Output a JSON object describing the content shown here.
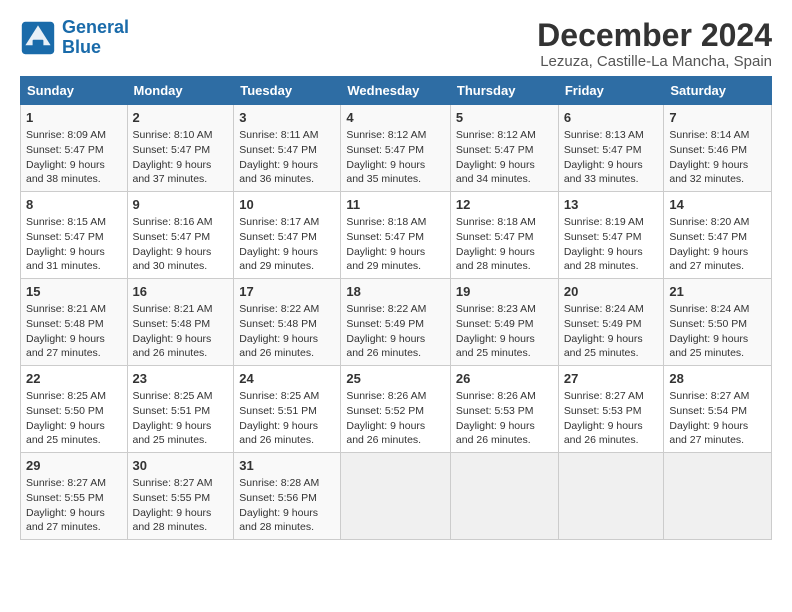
{
  "header": {
    "logo_line1": "General",
    "logo_line2": "Blue",
    "title": "December 2024",
    "subtitle": "Lezuza, Castille-La Mancha, Spain"
  },
  "columns": [
    "Sunday",
    "Monday",
    "Tuesday",
    "Wednesday",
    "Thursday",
    "Friday",
    "Saturday"
  ],
  "weeks": [
    [
      {
        "day": "1",
        "text": "Sunrise: 8:09 AM\nSunset: 5:47 PM\nDaylight: 9 hours\nand 38 minutes."
      },
      {
        "day": "2",
        "text": "Sunrise: 8:10 AM\nSunset: 5:47 PM\nDaylight: 9 hours\nand 37 minutes."
      },
      {
        "day": "3",
        "text": "Sunrise: 8:11 AM\nSunset: 5:47 PM\nDaylight: 9 hours\nand 36 minutes."
      },
      {
        "day": "4",
        "text": "Sunrise: 8:12 AM\nSunset: 5:47 PM\nDaylight: 9 hours\nand 35 minutes."
      },
      {
        "day": "5",
        "text": "Sunrise: 8:12 AM\nSunset: 5:47 PM\nDaylight: 9 hours\nand 34 minutes."
      },
      {
        "day": "6",
        "text": "Sunrise: 8:13 AM\nSunset: 5:47 PM\nDaylight: 9 hours\nand 33 minutes."
      },
      {
        "day": "7",
        "text": "Sunrise: 8:14 AM\nSunset: 5:46 PM\nDaylight: 9 hours\nand 32 minutes."
      }
    ],
    [
      {
        "day": "8",
        "text": "Sunrise: 8:15 AM\nSunset: 5:47 PM\nDaylight: 9 hours\nand 31 minutes."
      },
      {
        "day": "9",
        "text": "Sunrise: 8:16 AM\nSunset: 5:47 PM\nDaylight: 9 hours\nand 30 minutes."
      },
      {
        "day": "10",
        "text": "Sunrise: 8:17 AM\nSunset: 5:47 PM\nDaylight: 9 hours\nand 29 minutes."
      },
      {
        "day": "11",
        "text": "Sunrise: 8:18 AM\nSunset: 5:47 PM\nDaylight: 9 hours\nand 29 minutes."
      },
      {
        "day": "12",
        "text": "Sunrise: 8:18 AM\nSunset: 5:47 PM\nDaylight: 9 hours\nand 28 minutes."
      },
      {
        "day": "13",
        "text": "Sunrise: 8:19 AM\nSunset: 5:47 PM\nDaylight: 9 hours\nand 28 minutes."
      },
      {
        "day": "14",
        "text": "Sunrise: 8:20 AM\nSunset: 5:47 PM\nDaylight: 9 hours\nand 27 minutes."
      }
    ],
    [
      {
        "day": "15",
        "text": "Sunrise: 8:21 AM\nSunset: 5:48 PM\nDaylight: 9 hours\nand 27 minutes."
      },
      {
        "day": "16",
        "text": "Sunrise: 8:21 AM\nSunset: 5:48 PM\nDaylight: 9 hours\nand 26 minutes."
      },
      {
        "day": "17",
        "text": "Sunrise: 8:22 AM\nSunset: 5:48 PM\nDaylight: 9 hours\nand 26 minutes."
      },
      {
        "day": "18",
        "text": "Sunrise: 8:22 AM\nSunset: 5:49 PM\nDaylight: 9 hours\nand 26 minutes."
      },
      {
        "day": "19",
        "text": "Sunrise: 8:23 AM\nSunset: 5:49 PM\nDaylight: 9 hours\nand 25 minutes."
      },
      {
        "day": "20",
        "text": "Sunrise: 8:24 AM\nSunset: 5:49 PM\nDaylight: 9 hours\nand 25 minutes."
      },
      {
        "day": "21",
        "text": "Sunrise: 8:24 AM\nSunset: 5:50 PM\nDaylight: 9 hours\nand 25 minutes."
      }
    ],
    [
      {
        "day": "22",
        "text": "Sunrise: 8:25 AM\nSunset: 5:50 PM\nDaylight: 9 hours\nand 25 minutes."
      },
      {
        "day": "23",
        "text": "Sunrise: 8:25 AM\nSunset: 5:51 PM\nDaylight: 9 hours\nand 25 minutes."
      },
      {
        "day": "24",
        "text": "Sunrise: 8:25 AM\nSunset: 5:51 PM\nDaylight: 9 hours\nand 26 minutes."
      },
      {
        "day": "25",
        "text": "Sunrise: 8:26 AM\nSunset: 5:52 PM\nDaylight: 9 hours\nand 26 minutes."
      },
      {
        "day": "26",
        "text": "Sunrise: 8:26 AM\nSunset: 5:53 PM\nDaylight: 9 hours\nand 26 minutes."
      },
      {
        "day": "27",
        "text": "Sunrise: 8:27 AM\nSunset: 5:53 PM\nDaylight: 9 hours\nand 26 minutes."
      },
      {
        "day": "28",
        "text": "Sunrise: 8:27 AM\nSunset: 5:54 PM\nDaylight: 9 hours\nand 27 minutes."
      }
    ],
    [
      {
        "day": "29",
        "text": "Sunrise: 8:27 AM\nSunset: 5:55 PM\nDaylight: 9 hours\nand 27 minutes."
      },
      {
        "day": "30",
        "text": "Sunrise: 8:27 AM\nSunset: 5:55 PM\nDaylight: 9 hours\nand 28 minutes."
      },
      {
        "day": "31",
        "text": "Sunrise: 8:28 AM\nSunset: 5:56 PM\nDaylight: 9 hours\nand 28 minutes."
      },
      null,
      null,
      null,
      null
    ]
  ]
}
